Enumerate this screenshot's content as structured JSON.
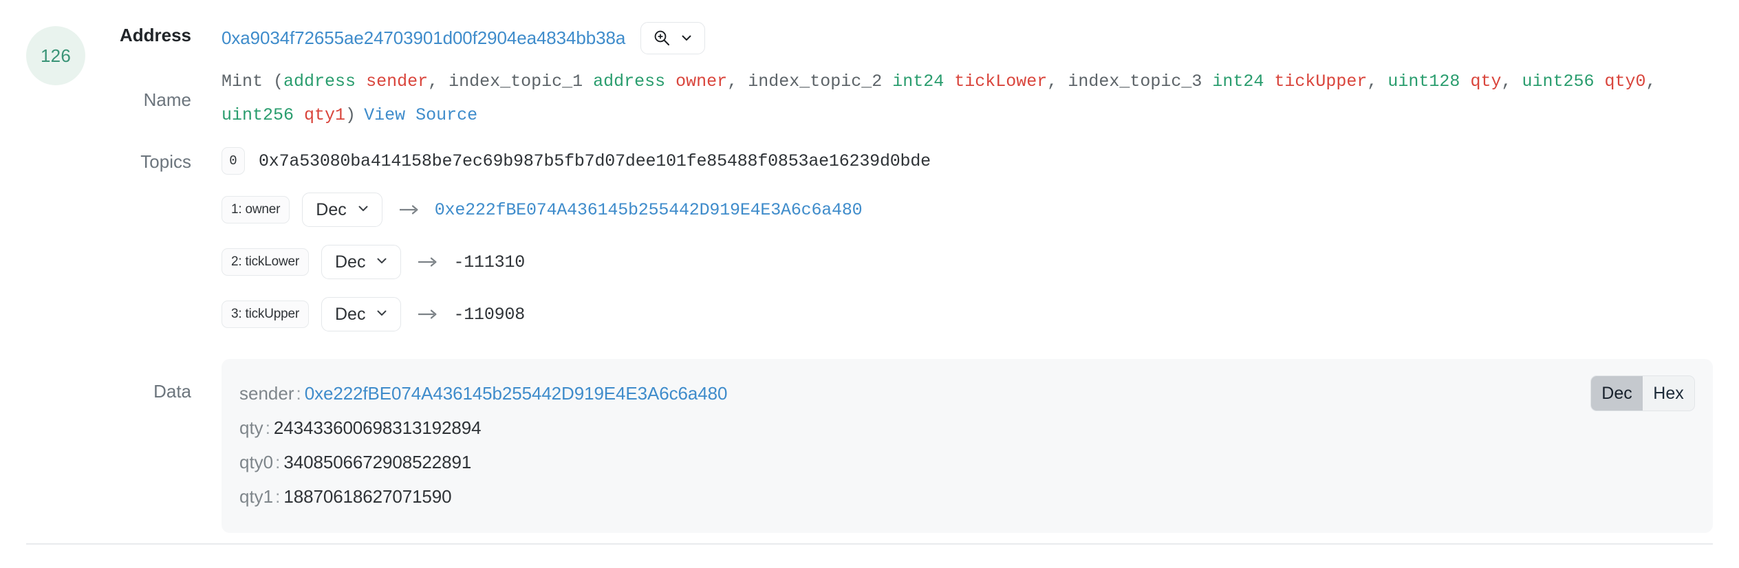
{
  "entry": {
    "index": "126",
    "index_badge_bg": "#e9f3ee",
    "index_badge_color": "#3a9477"
  },
  "labels": {
    "address": "Address",
    "name": "Name",
    "topics": "Topics",
    "data": "Data"
  },
  "address": {
    "value": "0xa9034f72655ae24703901d00f2904ea4834bb38a",
    "link_color": "#3f8ccb",
    "tools": {
      "search_icon": "magnifier-plus-icon",
      "chevron_icon": "chevron-down-icon"
    }
  },
  "name": {
    "event": "Mint",
    "open_paren": "(",
    "close_paren": ")",
    "params": [
      {
        "indexed": "",
        "type": "address",
        "name": "sender",
        "sep": ", "
      },
      {
        "indexed": "index_topic_1",
        "type": "address",
        "name": "owner",
        "sep": ", "
      },
      {
        "indexed": "index_topic_2",
        "type": "int24",
        "name": "tickLower",
        "sep": ", "
      },
      {
        "indexed": "index_topic_3",
        "type": "int24",
        "name": "tickUpper",
        "sep": ", "
      },
      {
        "indexed": "",
        "type": "uint128",
        "name": "qty",
        "sep": ", "
      },
      {
        "indexed": "",
        "type": "uint256",
        "name": "qty0",
        "sep": ", "
      },
      {
        "indexed": "",
        "type": "uint256",
        "name": "qty1",
        "sep": ""
      }
    ],
    "view_source": "View Source",
    "type_color": "#2a9d6e",
    "param_color": "#d9453c"
  },
  "topics": [
    {
      "badge": "0",
      "badge_named": false,
      "has_select": false,
      "select_label": "",
      "has_arrow": false,
      "value": "0x7a53080ba414158be7ec69b987b5fb7d07dee101fe85488f0853ae16239d0bde",
      "value_is_link": false
    },
    {
      "badge": "1: owner",
      "badge_named": true,
      "has_select": true,
      "select_label": "Dec",
      "has_arrow": true,
      "value": "0xe222fBE074A436145b255442D919E4E3A6c6a480",
      "value_is_link": true
    },
    {
      "badge": "2: tickLower",
      "badge_named": true,
      "has_select": true,
      "select_label": "Dec",
      "has_arrow": true,
      "value": "-111310",
      "value_is_link": false
    },
    {
      "badge": "3: tickUpper",
      "badge_named": true,
      "has_select": true,
      "select_label": "Dec",
      "has_arrow": true,
      "value": "-110908",
      "value_is_link": false
    }
  ],
  "data": {
    "fields": [
      {
        "key": "sender",
        "value": "0xe222fBE074A436145b255442D919E4E3A6c6a480",
        "is_link": true
      },
      {
        "key": "qty",
        "value": "243433600698313192894",
        "is_link": false
      },
      {
        "key": "qty0",
        "value": "3408506672908522891",
        "is_link": false
      },
      {
        "key": "qty1",
        "value": "18870618627071590",
        "is_link": false
      }
    ],
    "toggle": {
      "options": [
        "Dec",
        "Hex"
      ],
      "selected": "Dec"
    },
    "panel_bg": "#f7f8f9"
  }
}
